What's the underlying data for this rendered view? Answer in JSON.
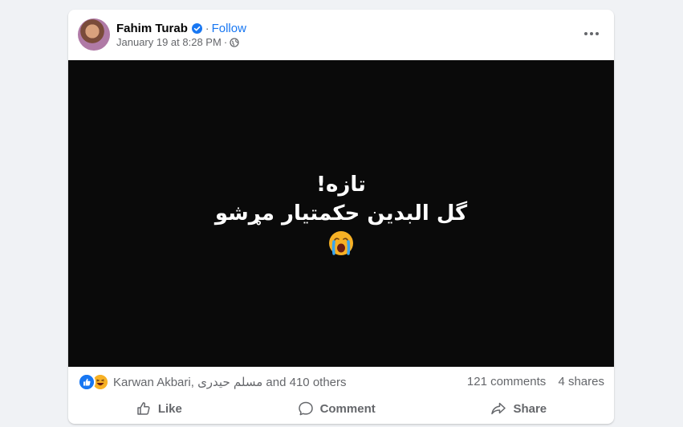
{
  "post": {
    "author": "Fahim Turab",
    "separator": "·",
    "follow_label": "Follow",
    "timestamp": "January 19 at 8:28 PM",
    "meta_separator": "·",
    "audience_icon": "globe-icon",
    "more_icon": "more-options-icon"
  },
  "media": {
    "line1": "تازه!",
    "line2": "گل البدین حکمتیار مړشو",
    "emoji_icon": "crying-face-emoji"
  },
  "stats": {
    "reaction_icons": [
      "like-reaction-icon",
      "haha-reaction-icon"
    ],
    "reactors_text": "Karwan Akbari, مسلم حیدری and 410 others",
    "comments": "121 comments",
    "shares": "4 shares"
  },
  "actions": {
    "like_label": "Like",
    "comment_label": "Comment",
    "share_label": "Share"
  },
  "colors": {
    "page_bg": "#f0f2f5",
    "card_bg": "#ffffff",
    "accent": "#1877f2",
    "muted_text": "#65676b",
    "media_bg": "#0a0a0a"
  }
}
